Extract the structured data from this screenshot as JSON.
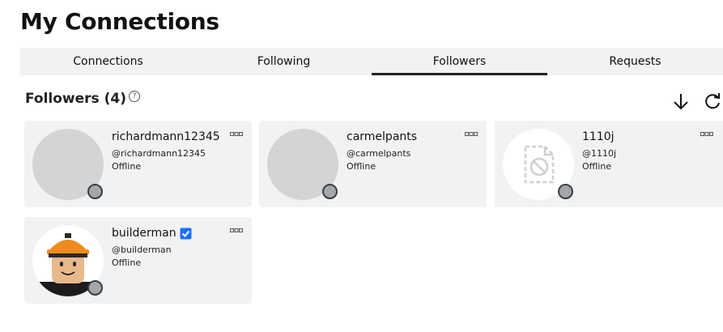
{
  "page": {
    "title": "My Connections"
  },
  "tabs": [
    {
      "label": "Connections",
      "active": false
    },
    {
      "label": "Following",
      "active": false
    },
    {
      "label": "Followers",
      "active": true
    },
    {
      "label": "Requests",
      "active": false
    }
  ],
  "section": {
    "title": "Followers (4)",
    "help_icon": "?"
  },
  "toolbar": {
    "download_icon": "download-arrow-icon",
    "refresh_icon": "refresh-icon"
  },
  "followers": [
    {
      "name": "richardmann12345",
      "handle": "@richardmann12345",
      "status": "Offline",
      "avatar": "blank-gray",
      "verified": false
    },
    {
      "name": "carmelpants",
      "handle": "@carmelpants",
      "status": "Offline",
      "avatar": "blank-gray",
      "verified": false
    },
    {
      "name": "1110j",
      "handle": "@1110j",
      "status": "Offline",
      "avatar": "unavailable-image",
      "verified": false
    },
    {
      "name": "builderman",
      "handle": "@builderman",
      "status": "Offline",
      "avatar": "builderman-avatar",
      "verified": true
    }
  ],
  "colors": {
    "card_bg": "#f2f2f3",
    "status_offline": "#a3a6ab",
    "verified_badge": "#1e6fff",
    "active_tab_underline": "#222222"
  }
}
